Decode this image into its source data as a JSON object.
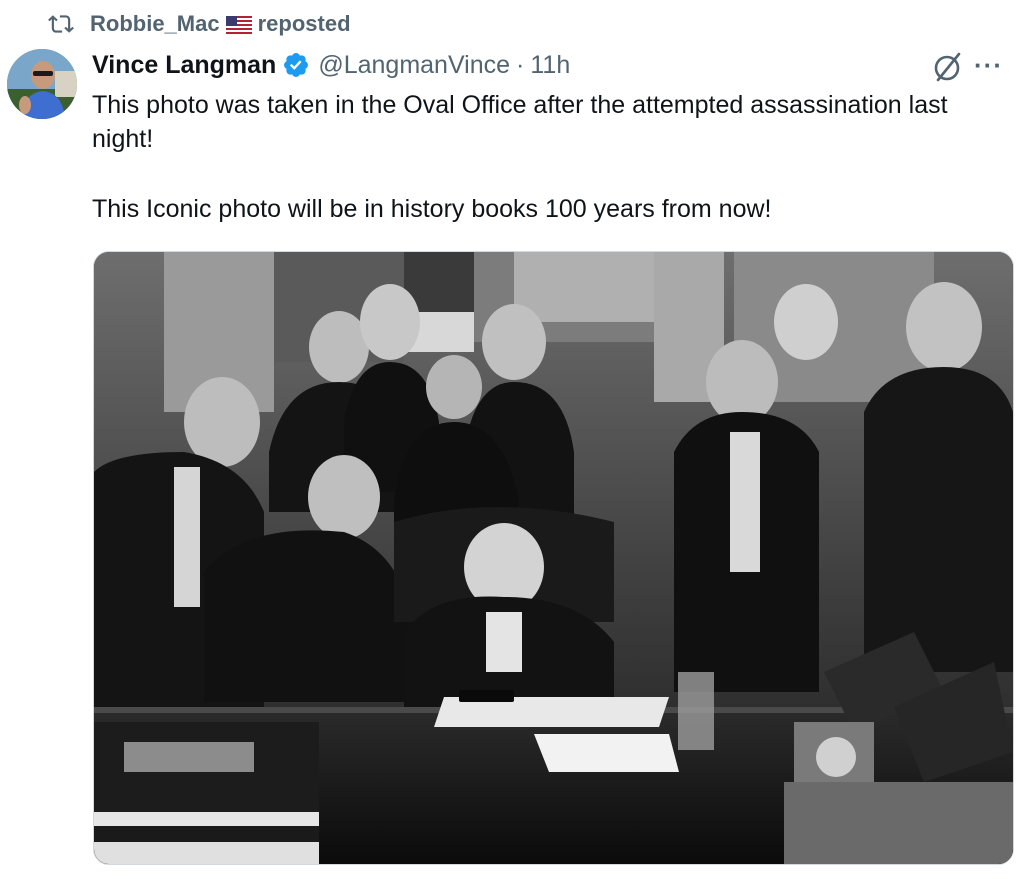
{
  "repost": {
    "user": "Robbie_Mac",
    "flag": "us-flag-emoji",
    "label": "reposted",
    "icon": "repost-icon"
  },
  "post": {
    "display_name": "Vince Langman",
    "verified": true,
    "verified_color": "#1d9bf0",
    "handle": "@LangmanVince",
    "separator": "·",
    "time": "11h",
    "text_line1": "This photo was taken in the Oval Office after the attempted assassination last night!",
    "text_line2": "This Iconic photo will be in history books 100 years from now!",
    "actions": {
      "grok_icon": "grok-icon",
      "more_label": "···"
    }
  },
  "media": {
    "kind": "black-and-white photo",
    "subject": "group of men in tuxedos gathered around a seated man at a desk looking at a phone"
  },
  "colors": {
    "text": "#0f1419",
    "muted": "#536471"
  }
}
